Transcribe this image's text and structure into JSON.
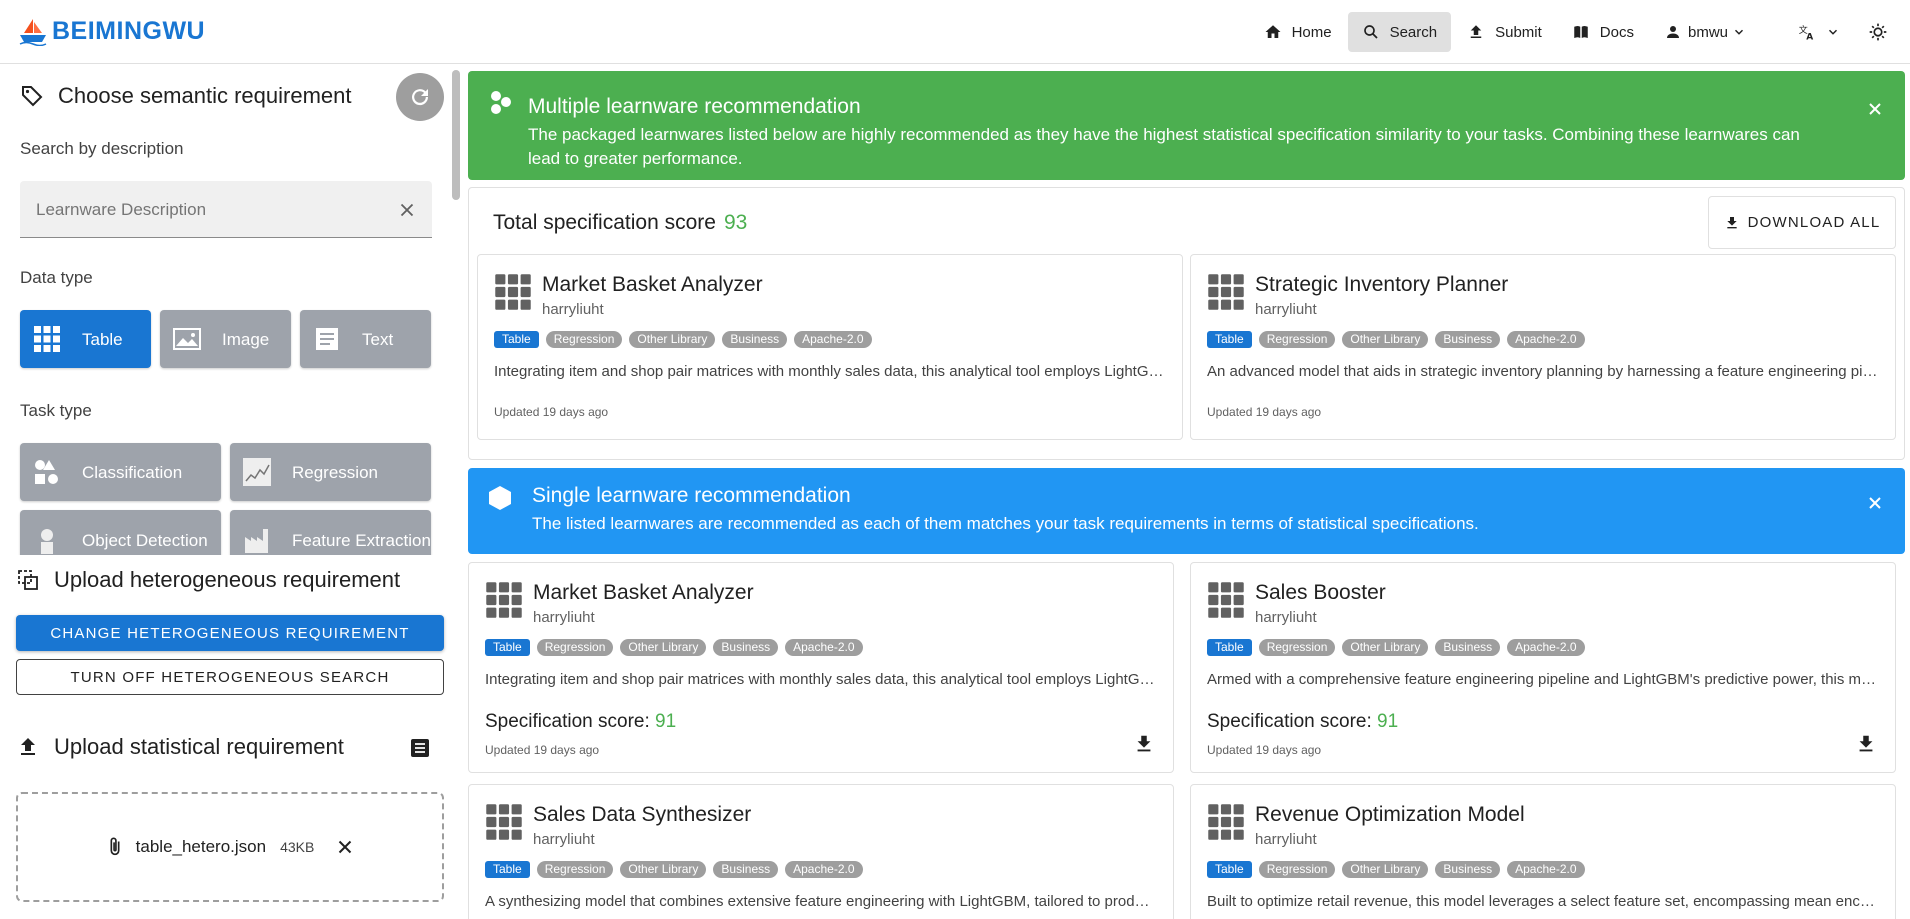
{
  "header": {
    "logo_text": "BEIMINGWU",
    "nav": [
      {
        "label": "Home",
        "icon": "home-icon"
      },
      {
        "label": "Search",
        "icon": "search-icon",
        "active": true
      },
      {
        "label": "Submit",
        "icon": "upload-icon"
      },
      {
        "label": "Docs",
        "icon": "book-icon"
      },
      {
        "label": "bmwu",
        "icon": "user-icon"
      }
    ],
    "colors": {
      "brand": "#1976d2"
    }
  },
  "left": {
    "semantic_title": "Choose semantic requirement",
    "search_label": "Search by description",
    "search_placeholder": "Learnware Description",
    "search_value": "",
    "data_type_label": "Data type",
    "data_types": [
      {
        "label": "Table",
        "icon": "table-grid-icon",
        "selected": true
      },
      {
        "label": "Image",
        "icon": "image-icon",
        "selected": false
      },
      {
        "label": "Text",
        "icon": "text-doc-icon",
        "selected": false
      }
    ],
    "task_type_label": "Task type",
    "task_types": [
      {
        "label": "Classification",
        "icon": "shapes-icon"
      },
      {
        "label": "Regression",
        "icon": "line-chart-icon"
      },
      {
        "label": "Object Detection",
        "icon": "robot-icon"
      },
      {
        "label": "Feature Extraction",
        "icon": "factory-icon"
      }
    ],
    "hetero_title": "Upload heterogeneous requirement",
    "change_hetero_btn": "Change heterogeneous requirement",
    "turn_off_btn": "Turn off heterogeneous search",
    "stat_title": "Upload statistical requirement",
    "file_name": "table_hetero.json",
    "file_size": "43KB"
  },
  "right": {
    "multi_alert": {
      "title": "Multiple learnware recommendation",
      "text": "The packaged learnwares listed below are highly recommended as they have the highest statistical specification similarity to your tasks. Combining these learnwares can lead to greater performance.",
      "color": "#4caf50"
    },
    "total_label": "Total specification score",
    "total_score": "93",
    "download_all": "DOWNLOAD ALL",
    "single_alert": {
      "title": "Single learnware recommendation",
      "text": "The listed learnwares are recommended as each of them matches your task requirements in terms of statistical specifications.",
      "color": "#2196f3"
    },
    "spec_label": "Specification score: ",
    "packaged": [
      {
        "title": "Market Basket Analyzer",
        "author": "harryliuht",
        "tags": [
          "Table",
          "Regression",
          "Other Library",
          "Business",
          "Apache-2.0"
        ],
        "desc": "Integrating item and shop pair matrices with monthly sales data, this analytical tool employs LightGBM for precise prediction of future sales trends.",
        "updated": "Updated 19 days ago"
      },
      {
        "title": "Strategic Inventory Planner",
        "author": "harryliuht",
        "tags": [
          "Table",
          "Regression",
          "Other Library",
          "Business",
          "Apache-2.0"
        ],
        "desc": "An advanced model that aids in strategic inventory planning by harnessing a feature engineering pipeline with LightGBM.",
        "updated": "Updated 19 days ago"
      }
    ],
    "single": [
      {
        "title": "Market Basket Analyzer",
        "author": "harryliuht",
        "tags": [
          "Table",
          "Regression",
          "Other Library",
          "Business",
          "Apache-2.0"
        ],
        "desc": "Integrating item and shop pair matrices with monthly sales data, this analytical tool employs LightGBM for precise prediction of future sales trends.",
        "score": "91",
        "updated": "Updated 19 days ago"
      },
      {
        "title": "Sales Booster",
        "author": "harryliuht",
        "tags": [
          "Table",
          "Regression",
          "Other Library",
          "Business",
          "Apache-2.0"
        ],
        "desc": "Armed with a comprehensive feature engineering pipeline and LightGBM's predictive power, this model boosts sales forecasting accuracy.",
        "score": "91",
        "updated": "Updated 19 days ago"
      },
      {
        "title": "Sales Data Synthesizer",
        "author": "harryliuht",
        "tags": [
          "Table",
          "Regression",
          "Other Library",
          "Business",
          "Apache-2.0"
        ],
        "desc": "A synthesizing model that combines extensive feature engineering with LightGBM, tailored to produce accurate sales forecasts.",
        "score": "",
        "updated": ""
      },
      {
        "title": "Revenue Optimization Model",
        "author": "harryliuht",
        "tags": [
          "Table",
          "Regression",
          "Other Library",
          "Business",
          "Apache-2.0"
        ],
        "desc": "Built to optimize retail revenue, this model leverages a select feature set, encompassing mean encodings and lag features.",
        "score": "",
        "updated": ""
      }
    ]
  }
}
